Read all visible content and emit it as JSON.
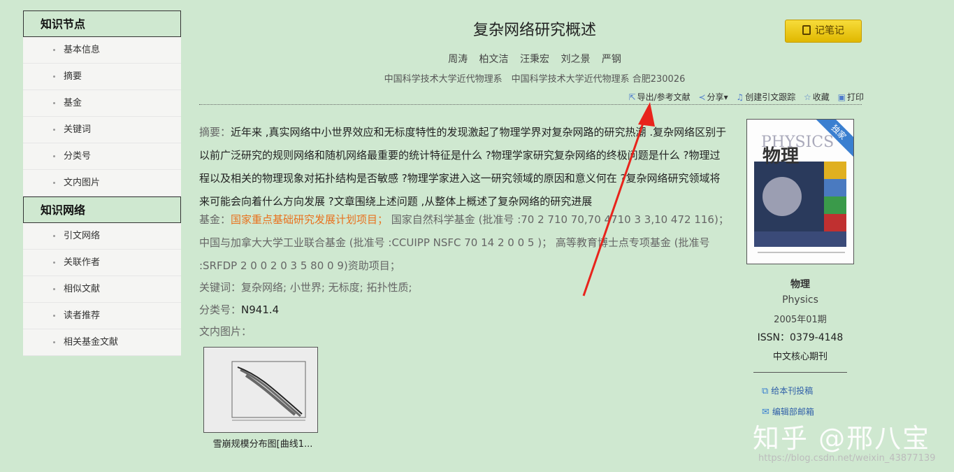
{
  "sidebar": {
    "section1": "知识节点",
    "items1": [
      "基本信息",
      "摘要",
      "基金",
      "关键词",
      "分类号",
      "文内图片"
    ],
    "section2": "知识网络",
    "items2": [
      "引文网络",
      "关联作者",
      "相似文献",
      "读者推荐",
      "相关基金文献"
    ]
  },
  "article": {
    "title": "复杂网络研究概述",
    "authors": [
      "周涛",
      "柏文洁",
      "汪秉宏",
      "刘之景",
      "严钢"
    ],
    "affiliation": "中国科学技术大学近代物理系　中国科学技术大学近代物理系 合肥230026",
    "abstract_label": "摘要：",
    "abstract": "近年来 ,真实网络中小世界效应和无标度特性的发现激起了物理学界对复杂网路的研究热潮 .复杂网络区别于以前广泛研究的规则网络和随机网络最重要的统计特征是什么 ?物理学家研究复杂网络的终极问题是什么 ?物理过程以及相关的物理现象对拓扑结构是否敏感 ?物理学家进入这一研究领域的原因和意义何在 ?复杂网络研究领域将来可能会向着什么方向发展 ?文章围绕上述问题 ,从整体上概述了复杂网络的研究进展",
    "fund_label": "基金：",
    "fund_highlight": "国家重点基础研究发展计划项目；",
    "fund_rest": " 国家自然科学基金 (批准号 :70 2 710 70,70 4710 3 3,10 472 116)； 中国与加拿大大学工业联合基金 (批准号 :CCUIPP NSFC 70 14 2 0 0 5 )； 高等教育博士点专项基金 (批准号 :SRFDP 2 0 0 2 0 3 5 80 0 9)资助项目；",
    "keywords_label": "关键词：",
    "keywords": "复杂网络; 小世界; 无标度; 拓扑性质;",
    "class_label": "分类号：",
    "class_value": "N941.4",
    "images_label": "文内图片：",
    "image_caption": "雪崩规模分布图[曲线1..."
  },
  "toolbar": {
    "export": "导出/参考文献",
    "share": "分享",
    "track": "创建引文跟踪",
    "favorite": "收藏",
    "print": "打印"
  },
  "note_button": "记笔记",
  "journal": {
    "badge": "独家",
    "cover_title_en": "PHYSICS",
    "cover_title_cn": "物理",
    "name_cn": "物理",
    "name_en": "Physics",
    "issue": "2005年01期",
    "issn": "ISSN：0379-4148",
    "core": "中文核心期刊",
    "link_submit": "给本刊投稿",
    "link_email": "编辑部邮箱"
  },
  "watermark": {
    "zhihu": "知乎 @邢八宝",
    "url": "https://blog.csdn.net/weixin_43877139"
  },
  "colors": {
    "background": "#cfe8d0",
    "highlight": "#e8721f",
    "accent_blue": "#3a7fd0",
    "note_button": "#f2cf1f",
    "arrow": "#e8241c"
  }
}
